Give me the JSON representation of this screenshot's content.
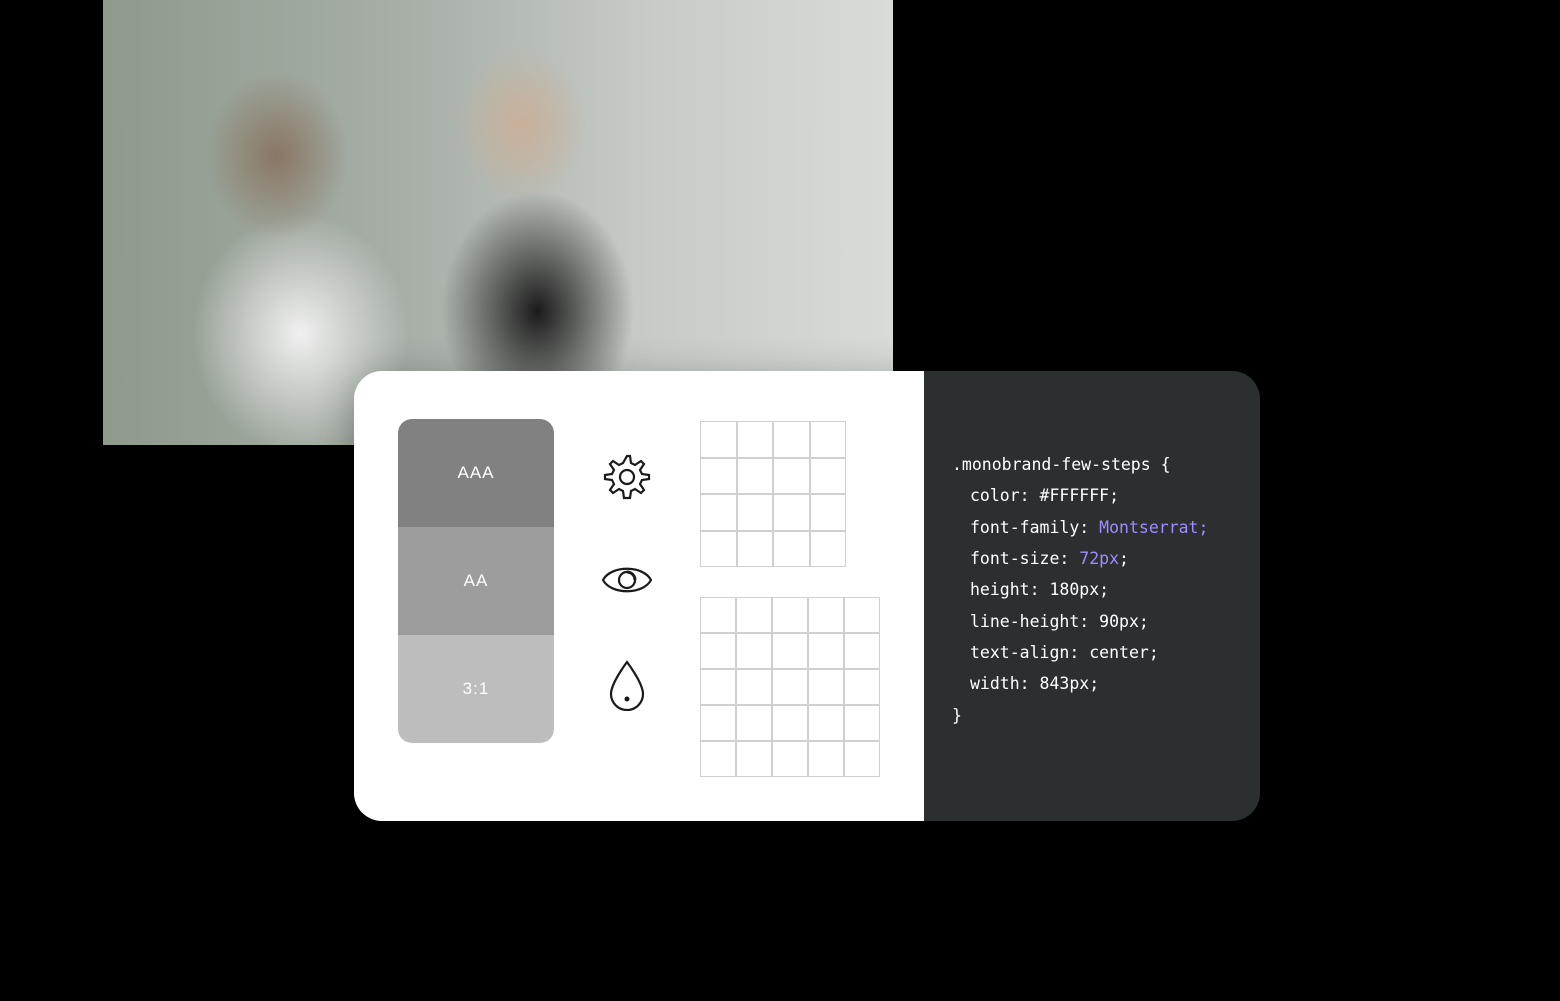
{
  "contrast": {
    "aaa": "AAA",
    "aa": "AA",
    "ratio31": "3:1"
  },
  "icons": {
    "gear": "gear-icon",
    "eye": "eye-icon",
    "drop": "drop-icon"
  },
  "grids": {
    "small": {
      "cols": 4,
      "rows": 4
    },
    "large": {
      "cols": 5,
      "rows": 5
    }
  },
  "code": {
    "selector": ".monobrand-few-steps",
    "open": " {",
    "close": "}",
    "lines": [
      {
        "prop": "color:",
        "val": " #FFFFFF;",
        "hl": false
      },
      {
        "prop": "font-family:",
        "val": " Montserrat;",
        "hl": true
      },
      {
        "prop": "font-size:",
        "val": " 72px",
        "hl": true,
        "suffix": ";"
      },
      {
        "prop": "height:",
        "val": " 180px;",
        "hl": false
      },
      {
        "prop": "line-height:",
        "val": " 90px;",
        "hl": false
      },
      {
        "prop": "text-align:",
        "val": " center;",
        "hl": false
      },
      {
        "prop": "width:",
        "val": " 843px;",
        "hl": false
      }
    ]
  }
}
